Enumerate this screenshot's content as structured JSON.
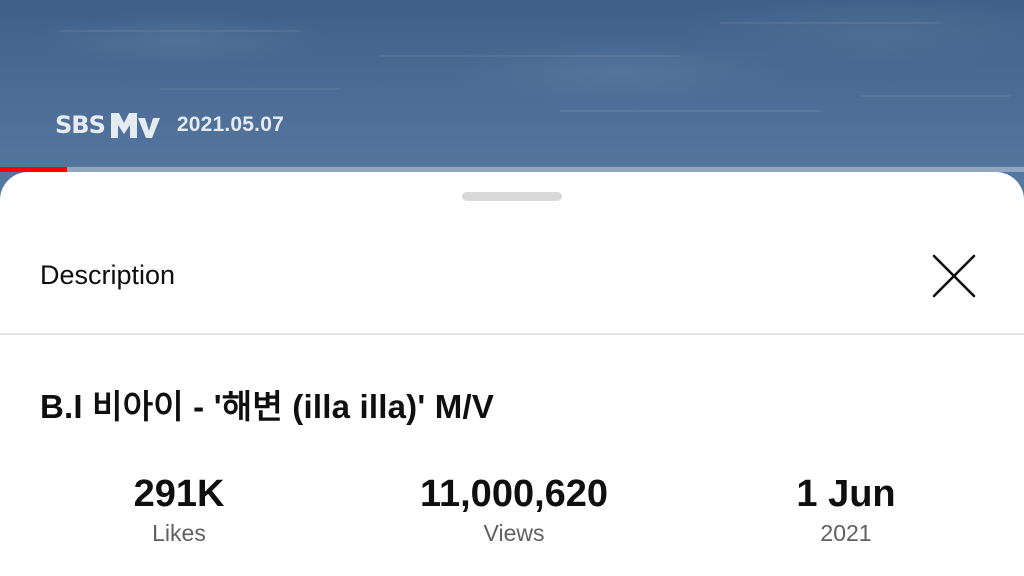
{
  "video": {
    "watermark_brand": "SBS MTV",
    "watermark_date": "2021.05.07",
    "progress_fraction": 0.065,
    "progress_color": "#ff0000"
  },
  "sheet": {
    "title": "Description",
    "close_icon": "close-icon"
  },
  "video_title": "B.I 비아이 - '해변 (illa illa)' M/V",
  "stats": [
    {
      "value": "291K",
      "label": "Likes"
    },
    {
      "value": "11,000,620",
      "label": "Views"
    },
    {
      "value": "1 Jun",
      "label": "2021"
    }
  ]
}
